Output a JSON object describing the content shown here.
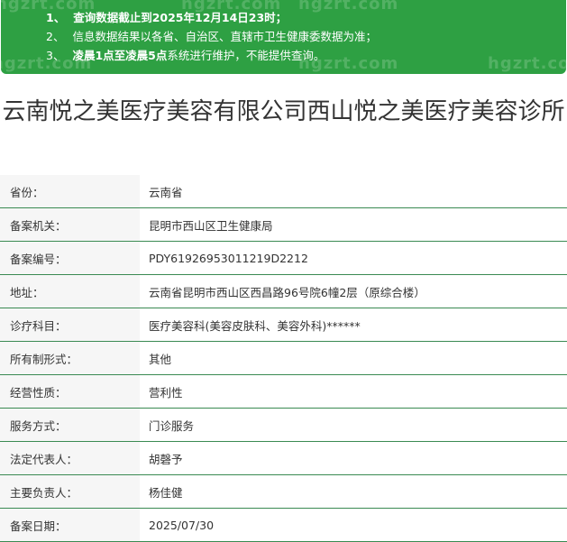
{
  "notice": {
    "items": [
      {
        "num": "1、",
        "text": "查询数据截止到2025年12月14日23时；",
        "bold": true
      },
      {
        "num": "2、",
        "text": "信息数据结果以各省、自治区、直辖市卫生健康委数据为准；",
        "bold": false
      },
      {
        "num": "3、",
        "bold_text": "凌晨1点至凌晨5点",
        "text": "系统进行维护，不能提供查询。",
        "bold": false
      }
    ],
    "watermark": "hgzrt.com"
  },
  "title": "云南悦之美医疗美容有限公司西山悦之美医疗美容诊所",
  "details": [
    {
      "label": "省份：",
      "value": "云南省"
    },
    {
      "label": "备案机关：",
      "value": "昆明市西山区卫生健康局"
    },
    {
      "label": "备案编号：",
      "value": "PDY61926953011219D2212"
    },
    {
      "label": "地址：",
      "value": "云南省昆明市西山区西昌路96号院6幢2层（原综合楼）"
    },
    {
      "label": "诊疗科目：",
      "value": "医疗美容科(美容皮肤科、美容外科)******"
    },
    {
      "label": "所有制形式：",
      "value": "其他"
    },
    {
      "label": "经营性质：",
      "value": "营利性"
    },
    {
      "label": "服务方式：",
      "value": "门诊服务"
    },
    {
      "label": "法定代表人：",
      "value": "胡磬予"
    },
    {
      "label": "主要负责人：",
      "value": "杨佳健"
    },
    {
      "label": "备案日期：",
      "value": "2025/07/30"
    }
  ],
  "colors": {
    "notice_bg": "#2ea043",
    "row_border": "#3a8a52",
    "label_bg": "#f6f6f6"
  }
}
